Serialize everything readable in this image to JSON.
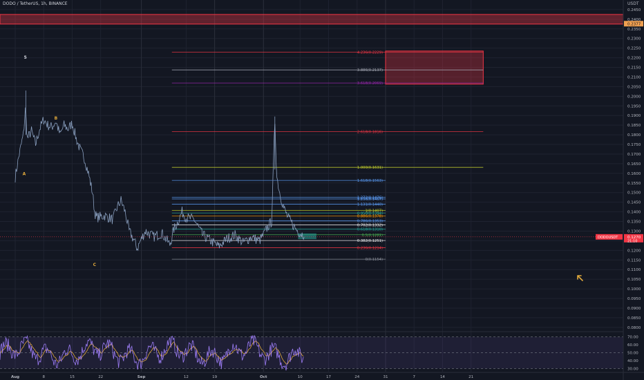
{
  "header": {
    "symbol_title": "DODO / TetherUS, 1h, BINANCE",
    "currency": "USDT"
  },
  "price_axis": {
    "ticks": [
      "0.2450",
      "0.2400",
      "0.2350",
      "0.2300",
      "0.2250",
      "0.2200",
      "0.2150",
      "0.2100",
      "0.2050",
      "0.2000",
      "0.1950",
      "0.1900",
      "0.1850",
      "0.1800",
      "0.1750",
      "0.1700",
      "0.1650",
      "0.1600",
      "0.1550",
      "0.1500",
      "0.1450",
      "0.1400",
      "0.1350",
      "0.1300",
      "0.1250",
      "0.1200",
      "0.1150",
      "0.1100",
      "0.1050",
      "0.1000",
      "0.0950",
      "0.0900",
      "0.0850",
      "0.0800"
    ],
    "range": [
      0.0785,
      0.25
    ],
    "highlight_price": "0.2377",
    "current_symbol": "DODOUSDT",
    "current_price": "0.1270",
    "current_time": "21:10"
  },
  "rsi_axis": {
    "ticks": [
      "70.00",
      "60.00",
      "50.00",
      "40.00",
      "30.00"
    ],
    "range": [
      26,
      75
    ]
  },
  "time_axis": {
    "labels": [
      "Aug",
      "8",
      "15",
      "22",
      "Sep",
      "12",
      "19",
      "Oct",
      "10",
      "17",
      "24",
      "31",
      "7",
      "14",
      "21"
    ],
    "tick_days": [
      0,
      7,
      14,
      21,
      31,
      42,
      49,
      61,
      70,
      77,
      84,
      91,
      98,
      105,
      112
    ]
  },
  "resistance_zone": {
    "from": 0.2375,
    "to": 0.2425,
    "color": "#f23645"
  },
  "target_zone": {
    "from": 0.2063,
    "to": 0.2235,
    "color": "#f23645"
  },
  "fib_levels": [
    {
      "label": "4.236(0.2229)",
      "price": 0.2229,
      "color": "#f23645"
    },
    {
      "label": "3.886(0.2137)",
      "price": 0.2137,
      "color": "#a5a9b4"
    },
    {
      "label": "3.618(0.2069)",
      "price": 0.2069,
      "color": "#9c27b0"
    },
    {
      "label": "2.618(0.1816)",
      "price": 0.1816,
      "color": "#f23645"
    },
    {
      "label": "1.000(0.1631)",
      "price": 0.1631,
      "color": "#c6d12c"
    },
    {
      "label": "1.618(0.1563)",
      "price": 0.1563,
      "color": "#5b9cf6"
    },
    {
      "label": "1.272(0.1476)",
      "price": 0.1476,
      "color": "#5b9cf6"
    },
    {
      "label": "1.236(0.1467)",
      "price": 0.1467,
      "color": "#5b9cf6"
    },
    {
      "label": "1.131(0.1440)",
      "price": 0.144,
      "color": "#5b9cf6"
    },
    {
      "label": "1(0.1407)",
      "price": 0.1407,
      "color": "#c6d12c"
    },
    {
      "label": "0.950(0.1394)",
      "price": 0.1394,
      "color": "#26a69a"
    },
    {
      "label": "0.886(0.1378)",
      "price": 0.1378,
      "color": "#ff9800"
    },
    {
      "label": "0.786(0.1353)",
      "price": 0.1353,
      "color": "#5b9cf6"
    },
    {
      "label": "0.702(0.1332)",
      "price": 0.1332,
      "color": "#f0f0f0"
    },
    {
      "label": "0.618(0.1310)",
      "price": 0.131,
      "color": "#26a69a"
    },
    {
      "label": "0.5(0.1281)",
      "price": 0.1281,
      "color": "#4caf50"
    },
    {
      "label": "0.382(0.1251)",
      "price": 0.1251,
      "color": "#f0f0f0"
    },
    {
      "label": "0.236(0.1214)",
      "price": 0.1214,
      "color": "#f23645"
    },
    {
      "label": "0(0.1154)",
      "price": 0.1154,
      "color": "#8a8e98"
    }
  ],
  "wave_labels": [
    {
      "text": "5",
      "day": 2.5,
      "price": 0.2195,
      "color": "#d1d4dc"
    },
    {
      "text": "B",
      "day": 10,
      "price": 0.188,
      "color": "#e0a93c"
    },
    {
      "text": "A",
      "day": 2.2,
      "price": 0.159,
      "color": "#e0a93c"
    },
    {
      "text": "C",
      "day": 19.5,
      "price": 0.1118,
      "color": "#e0a93c"
    }
  ],
  "colors": {
    "background": "#131722",
    "grid": "#1f2330",
    "price_line": "#8aa0c0",
    "rsi_line": "#9c7cf4",
    "rsi_ma": "#e0a93c",
    "current_price": "#f23645",
    "highlight_label": "#f0a050",
    "axis_text": "#b2b5be",
    "green_zone": "#26a69a",
    "arrow": "#e0a93c"
  }
}
